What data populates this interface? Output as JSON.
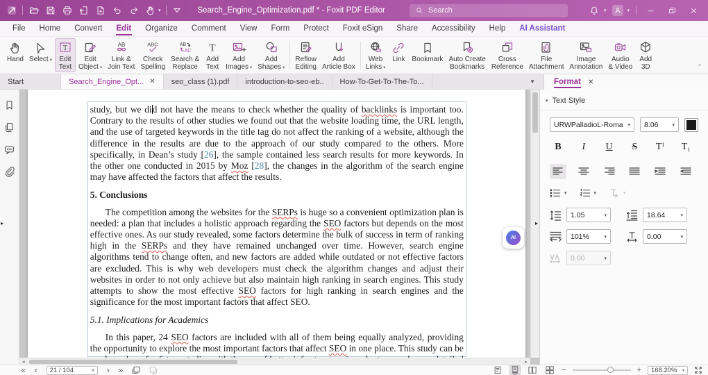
{
  "colors": {
    "accent": "#9c2f9c",
    "titlebar_start": "#9a4394",
    "titlebar_end": "#b763b1",
    "ai_accent": "#7a4fd0",
    "citation_link": "#4887a8",
    "squiggle": "#e05a4e"
  },
  "titlebar": {
    "title": "Search_Engine_Optimization.pdf * - Foxit PDF Editor",
    "search_placeholder": "Search",
    "left_icons": [
      "foxit-logo",
      "open-folder-icon",
      "save-icon",
      "print-icon",
      "export-icon",
      "add-file-icon",
      "undo-icon",
      "redo-icon",
      "hand-tool-icon",
      "quick-access-chevron-icon"
    ],
    "right_icons": [
      "bell-icon",
      "avatar",
      "minimize-button",
      "restore-button",
      "close-button"
    ]
  },
  "menubar": {
    "items": [
      {
        "label": "File"
      },
      {
        "label": "Home"
      },
      {
        "label": "Convert"
      },
      {
        "label": "Edit",
        "active": true
      },
      {
        "label": "Organize"
      },
      {
        "label": "Comment"
      },
      {
        "label": "View"
      },
      {
        "label": "Form"
      },
      {
        "label": "Protect"
      },
      {
        "label": "Foxit eSign"
      },
      {
        "label": "Share"
      },
      {
        "label": "Accessibility"
      },
      {
        "label": "Help"
      },
      {
        "label": "AI Assistant",
        "accent": true
      }
    ]
  },
  "ribbon": {
    "items": [
      {
        "name": "hand",
        "icon": "hand",
        "label": "Hand"
      },
      {
        "name": "select",
        "icon": "select",
        "label": "Select",
        "dd": true
      },
      {
        "name": "edit-text",
        "icon": "edit-text",
        "label": "Edit\nText",
        "active": true
      },
      {
        "name": "edit-object",
        "icon": "edit-object",
        "label": "Edit\nObject",
        "dd": true
      },
      {
        "name": "link-join-text",
        "icon": "link-join",
        "label": "Link &\nJoin Text"
      },
      {
        "name": "check-spelling",
        "icon": "check-spelling",
        "label": "Check\nSpelling"
      },
      {
        "name": "search-replace",
        "icon": "search-replace",
        "label": "Search &\nReplace"
      },
      {
        "name": "add-text",
        "icon": "add-text",
        "label": "Add\nText"
      },
      {
        "name": "add-images",
        "icon": "add-images",
        "label": "Add\nImages",
        "dd": true
      },
      {
        "name": "add-shapes",
        "icon": "add-shapes",
        "label": "Add\nShapes",
        "dd": true,
        "sep_after": true
      },
      {
        "name": "reflow-editing",
        "icon": "reflow",
        "label": "Reflow\nEditing"
      },
      {
        "name": "add-article-box",
        "icon": "article-box",
        "label": "Add\nArticle Box",
        "sep_after": true
      },
      {
        "name": "web-links",
        "icon": "web-links",
        "label": "Web\nLinks",
        "dd": true
      },
      {
        "name": "link",
        "icon": "link",
        "label": "Link"
      },
      {
        "name": "bookmark",
        "icon": "bookmark",
        "label": "Bookmark"
      },
      {
        "name": "auto-create-bookmarks",
        "icon": "auto-bookmarks",
        "label": "Auto Create\nBookmarks"
      },
      {
        "name": "cross-reference",
        "icon": "cross-ref",
        "label": "Cross\nReference"
      },
      {
        "name": "file-attachment",
        "icon": "file-attach",
        "label": "File\nAttachment"
      },
      {
        "name": "image-annotation",
        "icon": "image-annot",
        "label": "Image\nAnnotation"
      },
      {
        "name": "audio-video",
        "icon": "audio-video",
        "label": "Audio\n& Video"
      },
      {
        "name": "add-3d",
        "icon": "cube-3d",
        "label": "Add\n3D"
      }
    ]
  },
  "doc_tabs": [
    {
      "label": "Start"
    },
    {
      "label": "Search_Engine_Opt...",
      "active": true,
      "closable": true
    },
    {
      "label": "seo_class (1).pdf"
    },
    {
      "label": "introduction-to-seo-eb.."
    },
    {
      "label": "How-To-Get-To-The-To..."
    }
  ],
  "sidebar": {
    "icons": [
      "bookmarks-nav-icon",
      "pages-nav-icon",
      "comments-nav-icon",
      "attachments-nav-icon"
    ]
  },
  "document": {
    "blocks": [
      {
        "type": "para",
        "indent": false,
        "segments": [
          {
            "t": "study, but we di"
          },
          {
            "caret": true
          },
          {
            "t": "d not have the means to check whether the quality of "
          },
          {
            "t": "backlinks",
            "sq": true
          },
          {
            "t": " is important too. Contrary to the results of other studies we found out that the website loading time, the URL length, and the use of targeted keywords in the title tag do not affect the ranking of a website, although the difference in the results are due to the approach of our study compared to the others. More specifically, in Dean’s study ["
          },
          {
            "t": "26",
            "cite": true
          },
          {
            "t": "], the sample contained less search results for more keywords. In the other one conducted in 2015 by "
          },
          {
            "t": "Moz",
            "sq": true
          },
          {
            "t": " ["
          },
          {
            "t": "28",
            "cite": true
          },
          {
            "t": "], the changes in the algorithm of the search engine may have affected the factors that affect the results."
          }
        ]
      },
      {
        "type": "h-bold",
        "segments": [
          {
            "t": "5. Conclusions"
          }
        ]
      },
      {
        "type": "para",
        "indent": true,
        "segments": [
          {
            "t": "The competition among the websites for the "
          },
          {
            "t": "SERPs",
            "sq": true
          },
          {
            "t": " is huge so a convenient optimization plan is needed: a plan that includes a holistic approach regarding the "
          },
          {
            "t": "SEO",
            "sq": true
          },
          {
            "t": " factors but depends on the most effective ones. As our study revealed, some factors determine the bulk of success in term of ranking high in the "
          },
          {
            "t": "SERPs",
            "sq": true
          },
          {
            "t": " and they have remained unchanged over time. However, search engine algorithms tend to change often, and new factors are added while outdated or not effective factors are excluded. This is why web developers must check the algorithm changes and adjust their websites in order to not only achieve but also maintain high ranking in search engines. This study attempts to show the most effective "
          },
          {
            "t": "SEO",
            "sq": true
          },
          {
            "t": " factors for high ranking in search engines and the significance for the most important factors that affect SEO."
          }
        ]
      },
      {
        "type": "h-italic",
        "segments": [
          {
            "t": "5.1. Implications for Academics"
          }
        ]
      },
      {
        "type": "para",
        "indent": true,
        "segments": [
          {
            "t": "In this paper, 24 "
          },
          {
            "t": "SEO",
            "sq": true
          },
          {
            "t": " factors are included with all of them being equally analyzed, providing the opportunity to explore the most important factors that affect "
          },
          {
            "t": "SEO",
            "sq": true
          },
          {
            "t": " in one place. This study can be used as a base for future studies with the use of better infrastructure in order to reveal more detailed results"
          }
        ]
      }
    ]
  },
  "format_panel": {
    "tab_label": "Format",
    "section_label": "Text Style",
    "font_name": "URWPalladioL-Roma",
    "font_size": "8.06",
    "style_buttons": [
      "bold",
      "italic",
      "underline",
      "strikethrough",
      "superscript",
      "subscript"
    ],
    "align_buttons": [
      "align-left",
      "align-center",
      "align-right",
      "align-justify",
      "indent-increase",
      "indent-decrease"
    ],
    "line_spacing": "1.05",
    "paragraph_spacing": "18.64",
    "horizontal_scale": "101%",
    "char_spacing": "0.00",
    "word_spacing": "0.00"
  },
  "statusbar": {
    "page_display": "21 / 104",
    "zoom_value": "168.20%",
    "nav_icons": [
      "first-page-button",
      "prev-page-button",
      "next-page-button",
      "last-page-button",
      "previous-view-button",
      "next-view-button"
    ],
    "layout_icons": [
      "single-page-view",
      "continuous-view",
      "facing-view",
      "facing-continuous-view"
    ]
  },
  "ai_fab_label": "AI"
}
